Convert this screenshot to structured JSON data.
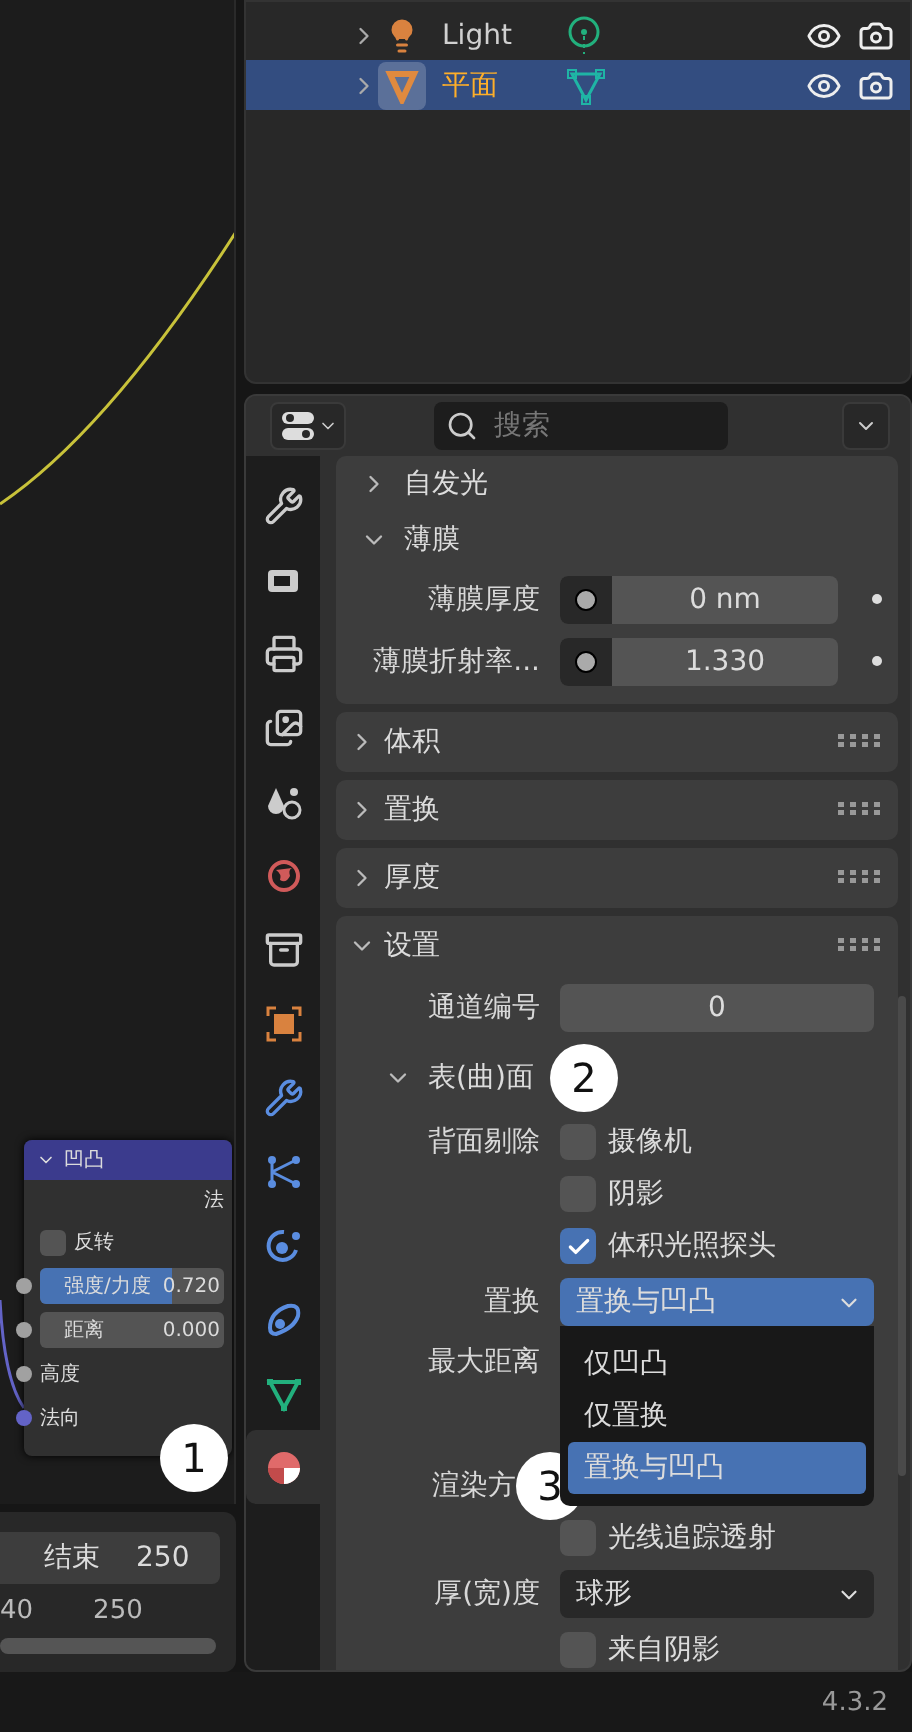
{
  "outliner": {
    "rows": [
      {
        "name": "Light",
        "kind": "light",
        "selected": false
      },
      {
        "name": "平面",
        "kind": "mesh",
        "selected": true
      }
    ]
  },
  "node_editor": {
    "marker": "1",
    "node": {
      "title": "凹凸",
      "output": "法",
      "invert": {
        "label": "反转",
        "checked": false
      },
      "fields": [
        {
          "label": "强度/力度",
          "value": "0.720",
          "level": 0.72
        },
        {
          "label": "距离",
          "value": "0.000"
        }
      ],
      "sockets": [
        {
          "label": "高度",
          "linked": false
        },
        {
          "label": "法向",
          "linked": true
        }
      ]
    }
  },
  "timeline": {
    "end_label": "结束",
    "end_value": "250",
    "ruler": [
      "40",
      "250"
    ]
  },
  "properties": {
    "search": {
      "placeholder": "搜索"
    },
    "tabs": [
      {
        "kind": "tool",
        "selected": false
      },
      {
        "kind": "render",
        "selected": false
      },
      {
        "kind": "output",
        "selected": false
      },
      {
        "kind": "view_layer",
        "selected": false
      },
      {
        "kind": "scene",
        "selected": false
      },
      {
        "kind": "world",
        "selected": false
      },
      {
        "kind": "collection",
        "selected": false
      },
      {
        "kind": "object",
        "selected": false
      },
      {
        "kind": "modifier",
        "selected": false
      },
      {
        "kind": "particles",
        "selected": false
      },
      {
        "kind": "physics",
        "selected": false
      },
      {
        "kind": "constraint",
        "selected": false
      },
      {
        "kind": "data",
        "selected": false
      },
      {
        "kind": "material",
        "selected": true
      }
    ],
    "panels": [
      {
        "items": [
          {
            "kind": "subheader",
            "label": "自发光",
            "expanded": false
          },
          {
            "kind": "subheader",
            "label": "薄膜",
            "expanded": true
          },
          {
            "kind": "slider",
            "label": "薄膜厚度",
            "value": "0 nm"
          },
          {
            "kind": "slider",
            "label": "薄膜折射率...",
            "value": "1.330"
          }
        ]
      },
      {
        "title": "体积",
        "expanded": false
      },
      {
        "title": "置换",
        "expanded": false
      },
      {
        "title": "厚度",
        "expanded": false
      },
      {
        "title": "设置",
        "expanded": true,
        "items": [
          {
            "kind": "number",
            "label": "通道编号",
            "value": "0"
          },
          {
            "kind": "subheader",
            "label": "表(曲)面",
            "expanded": true,
            "marker": "2"
          },
          {
            "kind": "checkbox",
            "label": "背面剔除",
            "text": "摄像机",
            "checked": false
          },
          {
            "kind": "checkbox",
            "text": "阴影",
            "checked": false
          },
          {
            "kind": "checkbox",
            "text": "体积光照探头",
            "checked": true
          },
          {
            "kind": "dropdown",
            "label": "置换",
            "value": "置换与凹凸",
            "open": true,
            "options": [
              {
                "label": "仅凹凸",
                "selected": false
              },
              {
                "label": "仅置换",
                "selected": false
              },
              {
                "label": "置换与凹凸",
                "selected": true
              }
            ]
          },
          {
            "kind": "label",
            "label": "最大距离"
          },
          {
            "kind": "gap"
          },
          {
            "kind": "label",
            "label": "渲染方",
            "marker": "3"
          },
          {
            "kind": "checkbox",
            "text": "光线追踪透射",
            "checked": false
          },
          {
            "kind": "dropdown",
            "label": "厚(宽)度",
            "value": "球形",
            "open": false
          },
          {
            "kind": "checkbox",
            "text": "来自阴影",
            "checked": false
          }
        ]
      }
    ]
  },
  "status_bar": {
    "version": "4.3.2"
  }
}
